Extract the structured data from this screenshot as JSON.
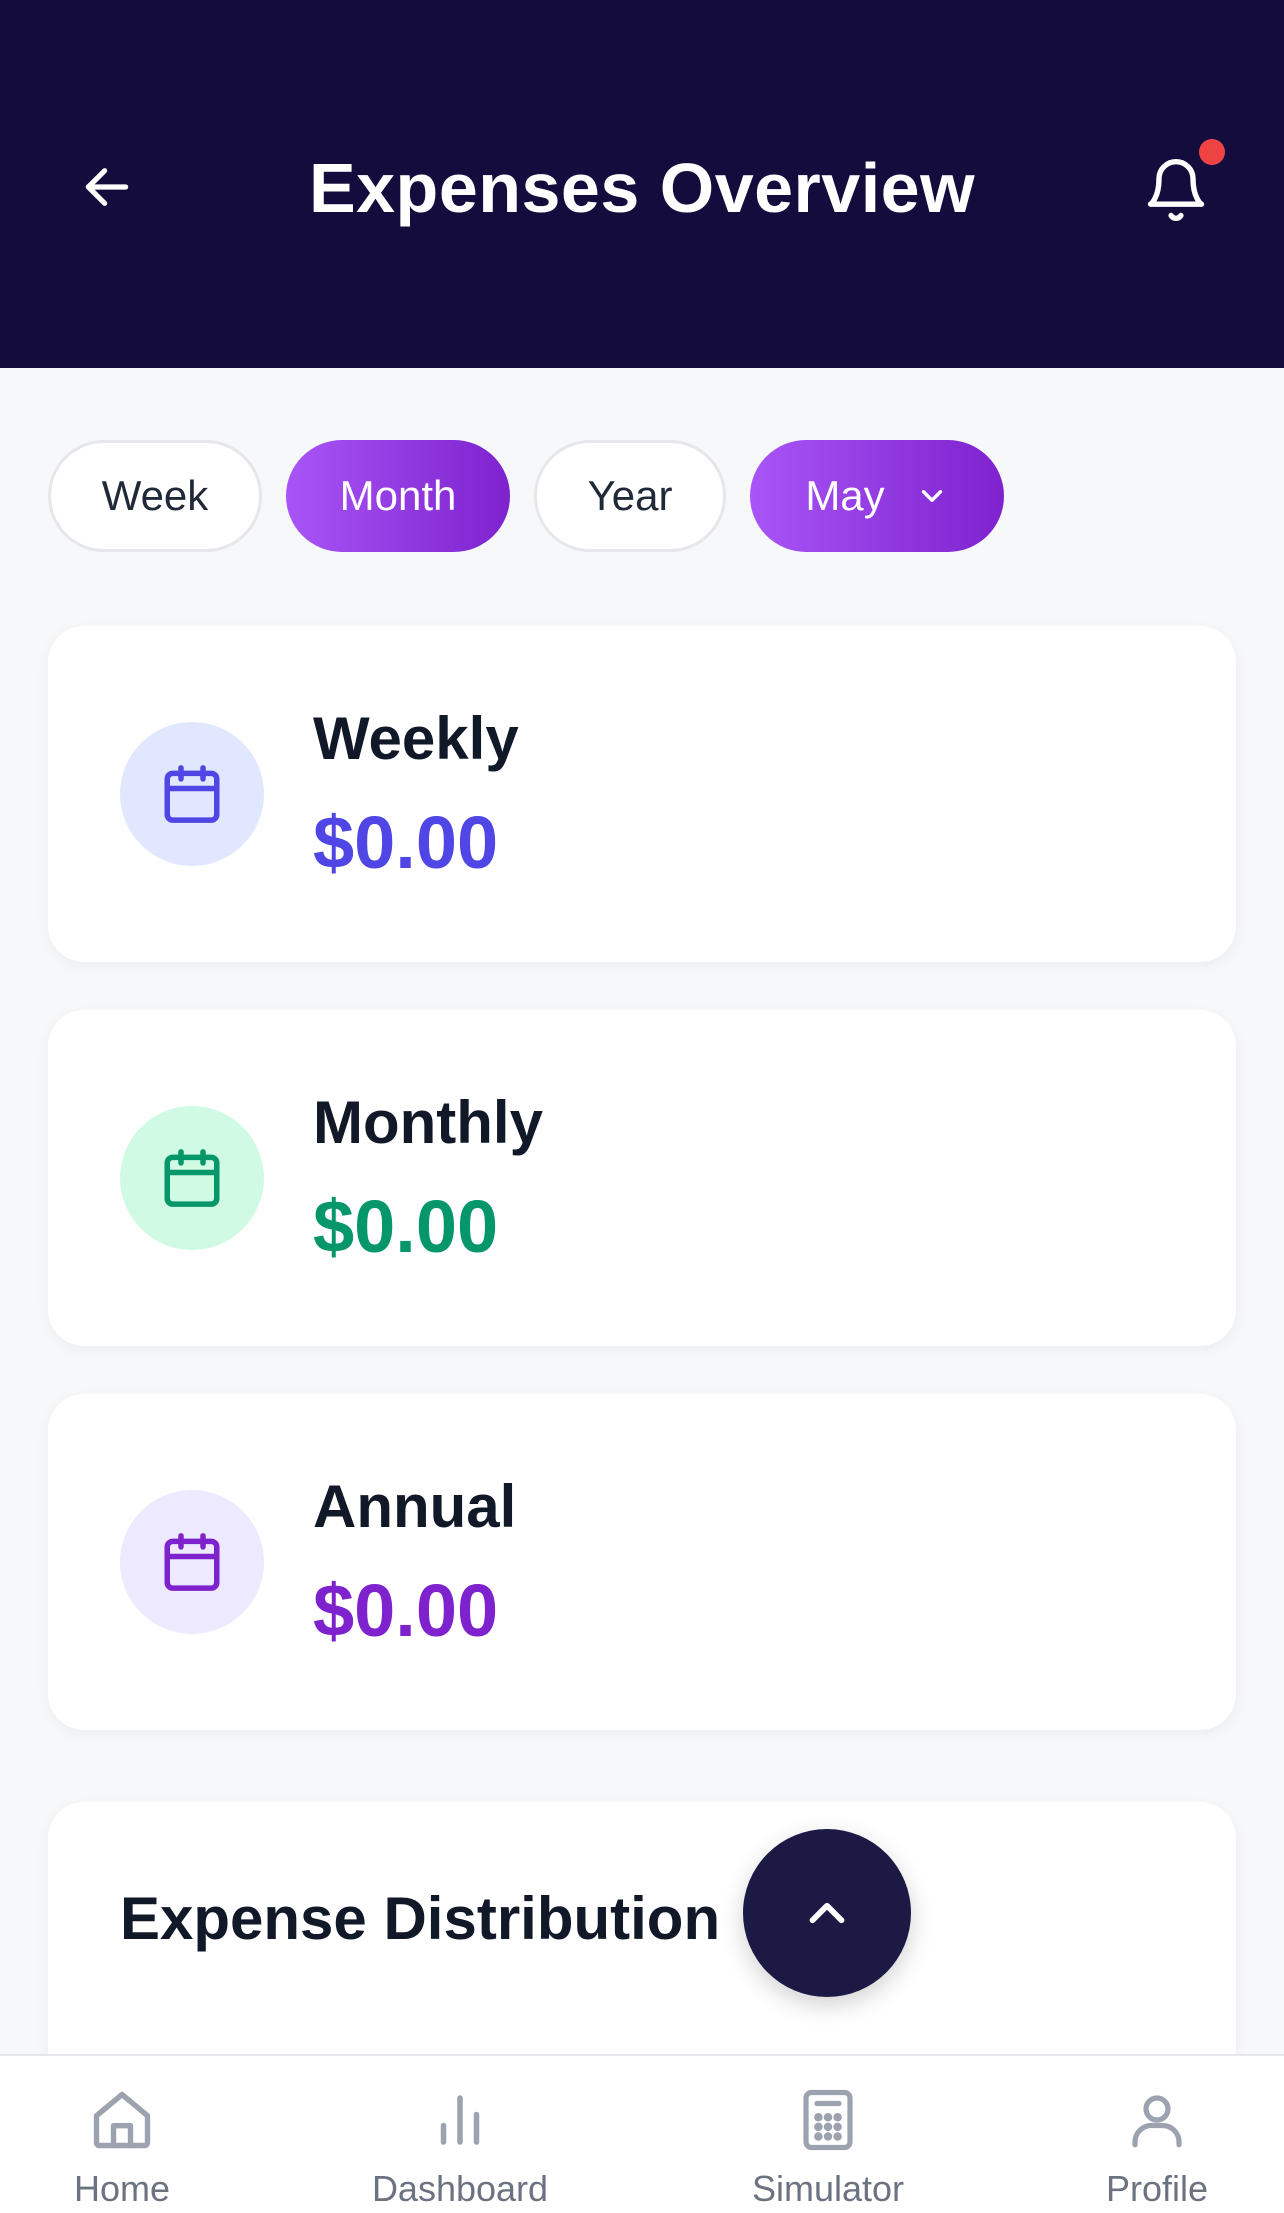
{
  "header": {
    "title": "Expenses Overview",
    "back_icon": "arrow-left-icon",
    "notification_icon": "bell-icon",
    "notification_dot_color": "#ef4444",
    "background": "#130c3c"
  },
  "filters": {
    "chips": [
      {
        "label": "Week",
        "active": false
      },
      {
        "label": "Month",
        "active": true
      },
      {
        "label": "Year",
        "active": false
      }
    ],
    "month_select": {
      "value": "May",
      "icon": "chevron-down-icon"
    }
  },
  "cards": [
    {
      "label": "Weekly",
      "value": "$0.00",
      "icon": "calendar-icon",
      "accent": "#4f46e5",
      "icon_bg": "#e0e7ff"
    },
    {
      "label": "Monthly",
      "value": "$0.00",
      "icon": "calendar-icon",
      "accent": "#059669",
      "icon_bg": "#d1fae5"
    },
    {
      "label": "Annual",
      "value": "$0.00",
      "icon": "calendar-icon",
      "accent": "#7e22ce",
      "icon_bg": "#ede9fe"
    }
  ],
  "distribution": {
    "title": "Expense Distribution"
  },
  "fab": {
    "icon": "chevron-up-icon"
  },
  "bottom_nav": {
    "items": [
      {
        "label": "Home",
        "icon": "home-icon"
      },
      {
        "label": "Dashboard",
        "icon": "bar-chart-icon"
      },
      {
        "label": "Simulator",
        "icon": "calculator-icon"
      },
      {
        "label": "Profile",
        "icon": "user-icon"
      }
    ]
  }
}
